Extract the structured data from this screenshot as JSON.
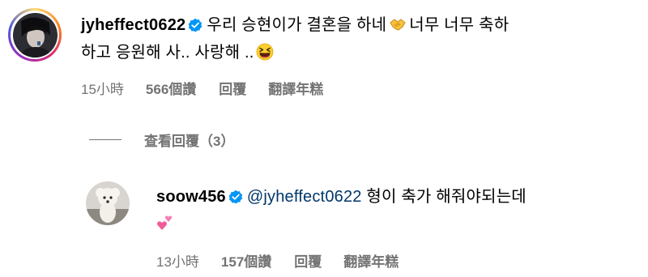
{
  "comments": [
    {
      "username": "jyheffect0622",
      "verified": true,
      "text_part1": "우리 승현이가 결혼을 하네",
      "text_part2": "너무 너무 축하",
      "text_line2": "하고 응원해 사.. 사랑해 ..",
      "emojis": [
        "handshake-emoji",
        "grinning-squinting-face-emoji"
      ],
      "time": "15小時",
      "likes": "566個讚",
      "reply_label": "回覆",
      "translate_label": "翻譯年糕"
    },
    {
      "username": "soow456",
      "verified": true,
      "mention": "@jyheffect0622",
      "text": "형이 축가 해줘야되는데",
      "emojis": [
        "two-hearts-emoji"
      ],
      "time": "13小時",
      "likes": "157個讚",
      "reply_label": "回覆",
      "translate_label": "翻譯年糕"
    }
  ],
  "view_replies": "查看回覆（3）",
  "colors": {
    "secondary_text": "#737373",
    "verified_blue": "#0095f6",
    "mention": "#00376b"
  }
}
